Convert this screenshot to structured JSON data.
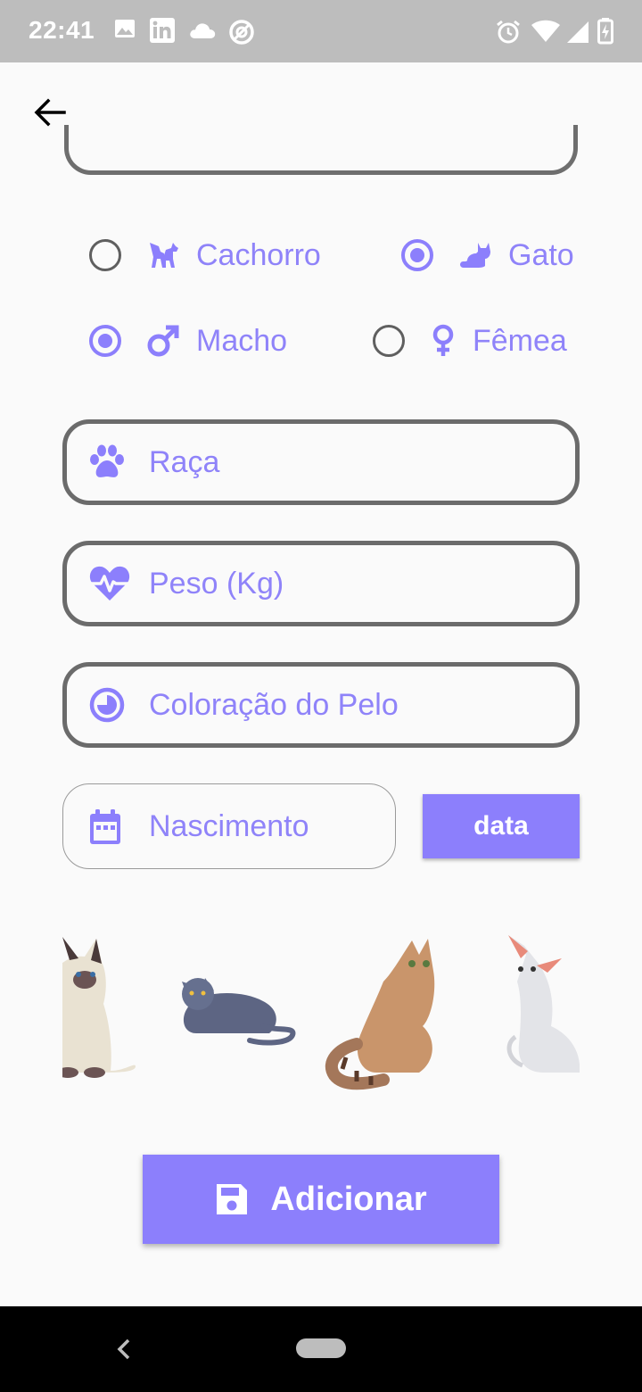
{
  "status_bar": {
    "time": "22:41",
    "icons": [
      "image-icon",
      "linkedin-icon",
      "cloud-icon",
      "at-sign-icon",
      "alarm-icon",
      "wifi-icon",
      "signal-icon",
      "battery-icon"
    ]
  },
  "app_bar": {
    "back_icon": "arrow-left-icon"
  },
  "species": {
    "options": [
      {
        "label": "Cachorro",
        "icon": "dog-icon",
        "selected": false
      },
      {
        "label": "Gato",
        "icon": "cat-icon",
        "selected": true
      }
    ]
  },
  "sex": {
    "options": [
      {
        "label": "Macho",
        "icon": "male-icon",
        "selected": true
      },
      {
        "label": "Fêmea",
        "icon": "female-icon",
        "selected": false
      }
    ]
  },
  "fields": {
    "breed": {
      "placeholder": "Raça",
      "icon": "paw-icon"
    },
    "weight": {
      "placeholder": "Peso (Kg)",
      "icon": "heart-pulse-icon"
    },
    "fur_color": {
      "placeholder": "Coloração do Pelo",
      "icon": "contrast-icon"
    },
    "birth": {
      "placeholder": "Nascimento",
      "icon": "calendar-icon"
    }
  },
  "date_button": {
    "label": "data"
  },
  "cat_images": [
    "siamese-cat",
    "grey-lying-cat",
    "orange-sitting-cat",
    "white-sphynx-cat"
  ],
  "add_button": {
    "label": "Adicionar",
    "icon": "save-icon"
  },
  "colors": {
    "accent": "#8c7ffc",
    "label": "#8f83f9",
    "border": "#6b6b6b",
    "background": "#fafafa"
  }
}
